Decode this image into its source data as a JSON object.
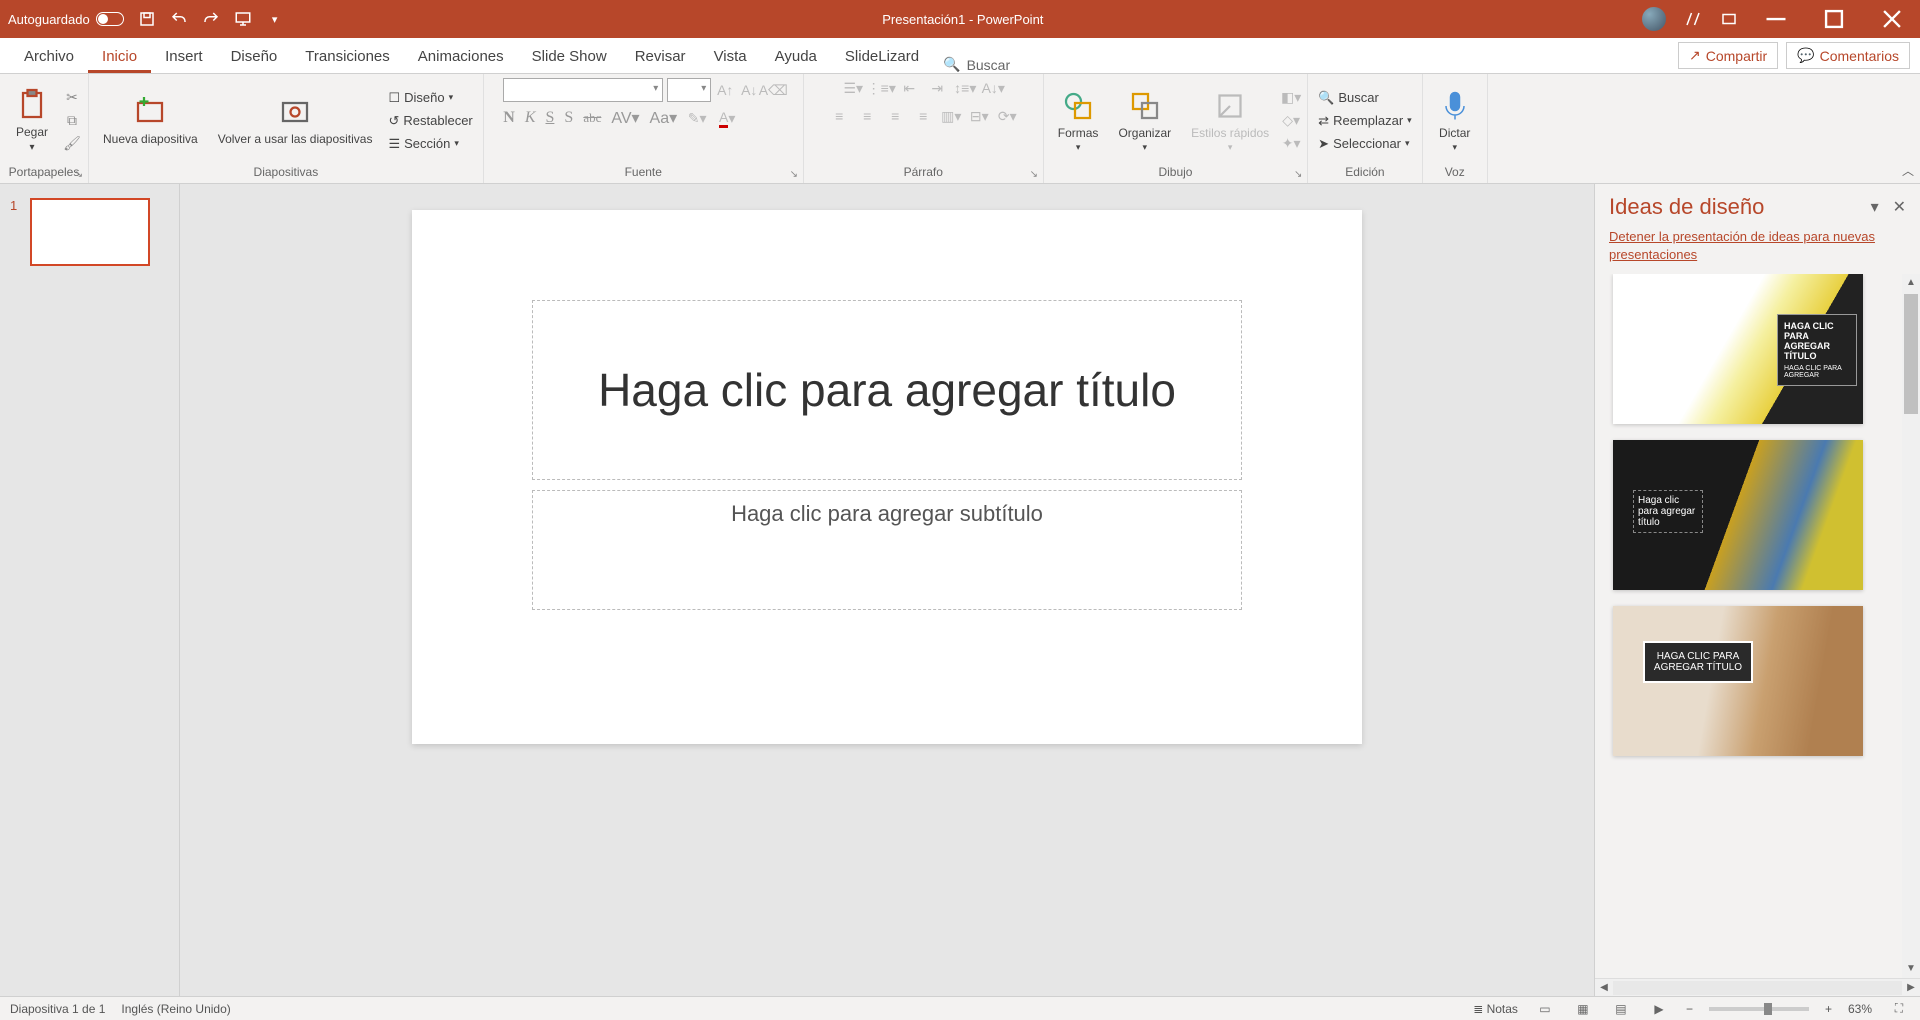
{
  "titlebar": {
    "autosave": "Autoguardado",
    "title": "Presentación1  -  PowerPoint"
  },
  "tabs": {
    "archivo": "Archivo",
    "inicio": "Inicio",
    "insert": "Insert",
    "diseno": "Diseño",
    "transiciones": "Transiciones",
    "animaciones": "Animaciones",
    "slideshow": "Slide Show",
    "revisar": "Revisar",
    "vista": "Vista",
    "ayuda": "Ayuda",
    "slidelizard": "SlideLizard",
    "buscar": "Buscar",
    "compartir": "Compartir",
    "comentarios": "Comentarios"
  },
  "ribbon": {
    "portapapeles": {
      "label": "Portapapeles",
      "pegar": "Pegar"
    },
    "diapositivas": {
      "label": "Diapositivas",
      "nueva": "Nueva diapositiva",
      "volver": "Volver a usar las diapositivas",
      "diseno": "Diseño",
      "restablecer": "Restablecer",
      "seccion": "Sección"
    },
    "fuente": {
      "label": "Fuente",
      "n": "N",
      "k": "K",
      "s1": "S",
      "s2": "S",
      "abc": "abc",
      "av": "AV",
      "aa": "Aa"
    },
    "parrafo": {
      "label": "Párrafo"
    },
    "dibujo": {
      "label": "Dibujo",
      "formas": "Formas",
      "organizar": "Organizar",
      "estilos": "Estilos rápidos"
    },
    "edicion": {
      "label": "Edición",
      "buscar": "Buscar",
      "reemplazar": "Reemplazar",
      "seleccionar": "Seleccionar"
    },
    "voz": {
      "label": "Voz",
      "dictar": "Dictar"
    }
  },
  "thumbs": {
    "n1": "1"
  },
  "slide": {
    "title_placeholder": "Haga clic para agregar título",
    "subtitle_placeholder": "Haga clic para agregar subtítulo"
  },
  "design_pane": {
    "title": "Ideas de diseño",
    "stop_link": "Detener la presentación de ideas para nuevas presentaciones",
    "idea1_title": "HAGA CLIC PARA AGREGAR TÍTULO",
    "idea1_sub": "HAGA CLIC PARA AGREGAR",
    "idea2_title": "Haga clic para agregar título",
    "idea3_title": "HAGA CLIC PARA AGREGAR TÍTULO"
  },
  "statusbar": {
    "slide_info": "Diapositiva 1 de 1",
    "language": "Inglés (Reino Unido)",
    "notas": "Notas",
    "zoom": "63%"
  }
}
